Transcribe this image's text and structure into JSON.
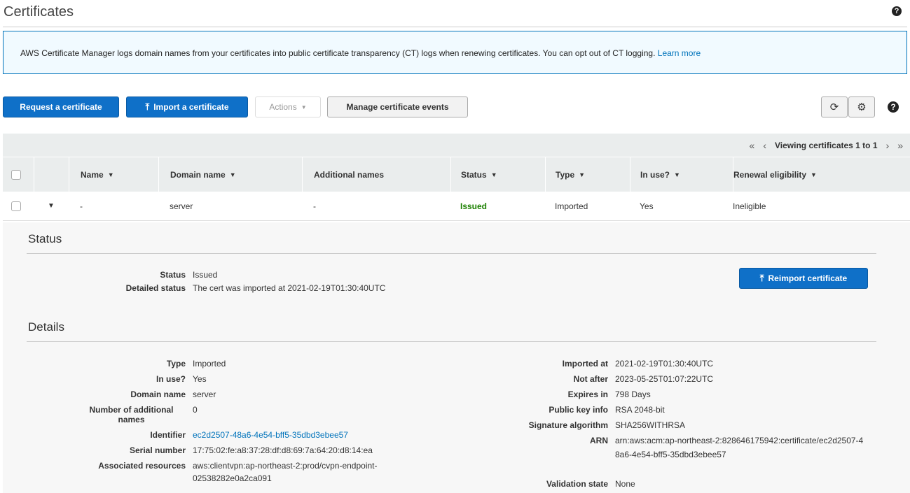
{
  "page": {
    "title": "Certificates"
  },
  "banner": {
    "text": "AWS Certificate Manager logs domain names from your certificates into public certificate transparency (CT) logs when renewing certificates. You can opt out of CT logging.",
    "link": "Learn more"
  },
  "toolbar": {
    "request": "Request a certificate",
    "import": "Import a certificate",
    "actions": "Actions",
    "manage_events": "Manage certificate events"
  },
  "pager": {
    "first": "«",
    "prev": "‹",
    "text": "Viewing certificates 1 to 1",
    "next": "›",
    "last": "»"
  },
  "table": {
    "columns": [
      "Name",
      "Domain name",
      "Additional names",
      "Status",
      "Type",
      "In use?",
      "Renewal eligibility"
    ],
    "row": {
      "name": "-",
      "domain": "server",
      "additional": "-",
      "status": "Issued",
      "type": "Imported",
      "in_use": "Yes",
      "renewal": "Ineligible"
    }
  },
  "status_section": {
    "title": "Status",
    "status_label": "Status",
    "status_value": "Issued",
    "detailed_label": "Detailed status",
    "detailed_value": "The cert was imported at 2021-02-19T01:30:40UTC",
    "reimport": "Reimport certificate"
  },
  "details_section": {
    "title": "Details",
    "left": [
      {
        "k": "Type",
        "v": "Imported"
      },
      {
        "k": "In use?",
        "v": "Yes"
      },
      {
        "k": "Domain name",
        "v": "server"
      },
      {
        "k": "Number of additional names",
        "v": "0"
      },
      {
        "k": "Identifier",
        "v": "ec2d2507-48a6-4e54-bff5-35dbd3ebee57"
      },
      {
        "k": "Serial number",
        "v": "17:75:02:fe:a8:37:28:df:d8:69:7a:64:20:d8:14:ea"
      },
      {
        "k": "Associated resources",
        "v": "aws:clientvpn:ap-northeast-2:prod/cvpn-endpoint-02538282e0a2ca091"
      }
    ],
    "right": [
      {
        "k": "Imported at",
        "v": "2021-02-19T01:30:40UTC"
      },
      {
        "k": "Not after",
        "v": "2023-05-25T01:07:22UTC"
      },
      {
        "k": "Expires in",
        "v": "798 Days"
      },
      {
        "k": "Public key info",
        "v": "RSA 2048-bit"
      },
      {
        "k": "Signature algorithm",
        "v": "SHA256WITHRSA"
      },
      {
        "k": "ARN",
        "v": "arn:aws:acm:ap-northeast-2:828646175942:certificate/ec2d2507-48a6-4e54-bff5-35dbd3ebee57"
      },
      {
        "k": "Validation state",
        "v": "None"
      }
    ]
  },
  "colors": {
    "primary": "#0f70c8",
    "link": "#0073bb",
    "success": "#1d8102"
  }
}
